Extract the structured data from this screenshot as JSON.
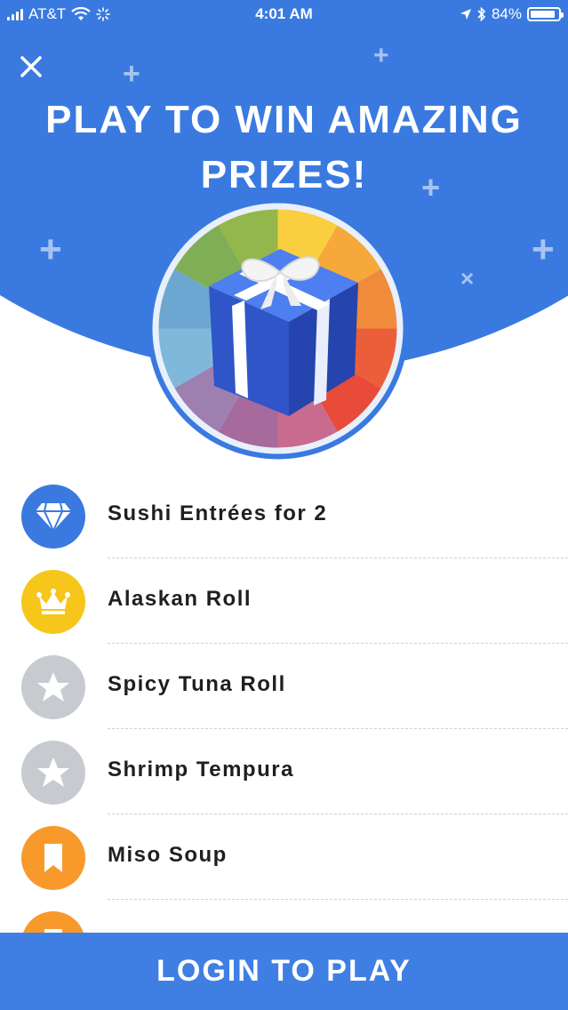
{
  "status_bar": {
    "carrier": "AT&T",
    "time": "4:01 AM",
    "battery": "84%",
    "battery_level": 0.84,
    "icons": [
      "signal-icon",
      "wifi-icon",
      "activity-icon",
      "location-icon",
      "bluetooth-icon",
      "battery-icon"
    ]
  },
  "header": {
    "close_icon": "close-icon",
    "title_line1": "PLAY TO WIN AMAZING",
    "title_line2": "PRIZES!"
  },
  "hero": {
    "graphic": "gift-box-prize-wheel",
    "wheel_colors": [
      "#f9cf3f",
      "#f6a93a",
      "#ef8b3b",
      "#ea5f3a",
      "#e84b3a",
      "#c96a8f",
      "#a66a9c",
      "#9d7fb0",
      "#7fb8db",
      "#6ca7d2",
      "#7fae57",
      "#94b74c"
    ]
  },
  "prizes": [
    {
      "label": "Sushi Entrées for 2",
      "icon": "diamond-icon",
      "color": "#3a7ae0"
    },
    {
      "label": "Alaskan Roll",
      "icon": "crown-icon",
      "color": "#f7c61b"
    },
    {
      "label": "Spicy Tuna Roll",
      "icon": "star-icon",
      "color": "#c7cbd0"
    },
    {
      "label": "Shrimp Tempura",
      "icon": "star-icon",
      "color": "#c7cbd0"
    },
    {
      "label": "Miso Soup",
      "icon": "bookmark-icon",
      "color": "#f79a2b"
    },
    {
      "label": "",
      "icon": "bookmark-icon",
      "color": "#f79a2b"
    }
  ],
  "footer": {
    "login_label": "LOGIN TO PLAY"
  },
  "colors": {
    "brand_blue": "#3a7ae0",
    "footer_blue": "#3f7fe3"
  }
}
